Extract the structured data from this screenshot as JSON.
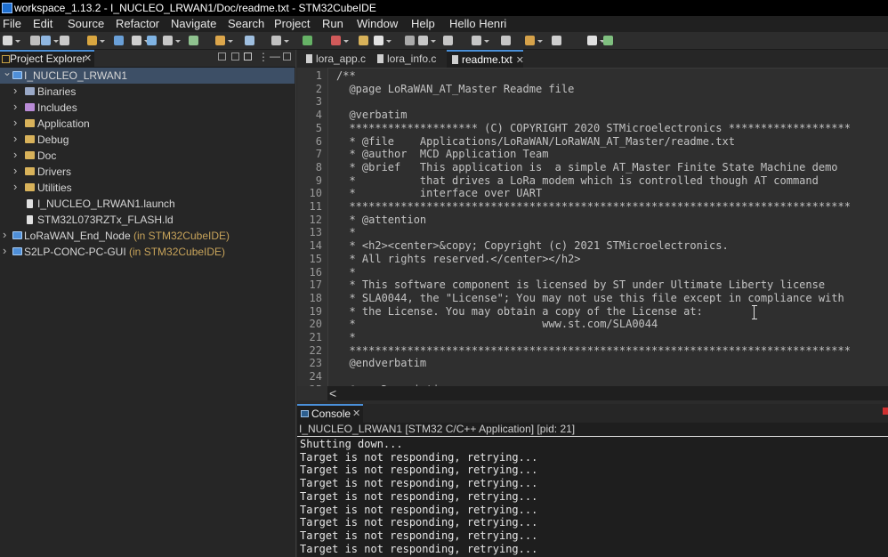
{
  "window": {
    "title": "workspace_1.13.2 - I_NUCLEO_LRWAN1/Doc/readme.txt - STM32CubeIDE"
  },
  "menu": [
    "File",
    "Edit",
    "Source",
    "Refactor",
    "Navigate",
    "Search",
    "Project",
    "Run",
    "Window",
    "Help",
    "Hello Henri"
  ],
  "project_explorer": {
    "tab_label": "Project Explorer",
    "close": "✕",
    "tree": [
      {
        "label": "I_NUCLEO_LRWAN1",
        "decoration": "",
        "icon": "project",
        "level": 0,
        "expanded": true,
        "selected": true
      },
      {
        "label": "Binaries",
        "decoration": "",
        "icon": "binaries",
        "level": 1,
        "expanded": false
      },
      {
        "label": "Includes",
        "decoration": "",
        "icon": "includes",
        "level": 1,
        "expanded": false
      },
      {
        "label": "Application",
        "decoration": "",
        "icon": "folder",
        "level": 1,
        "expanded": false
      },
      {
        "label": "Debug",
        "decoration": "",
        "icon": "folder",
        "level": 1,
        "expanded": false
      },
      {
        "label": "Doc",
        "decoration": "",
        "icon": "folder",
        "level": 1,
        "expanded": false
      },
      {
        "label": "Drivers",
        "decoration": "",
        "icon": "folder",
        "level": 1,
        "expanded": false
      },
      {
        "label": "Utilities",
        "decoration": "",
        "icon": "folder",
        "level": 1,
        "expanded": false
      },
      {
        "label": "I_NUCLEO_LRWAN1.launch",
        "decoration": "",
        "icon": "file",
        "level": 1,
        "leaf": true
      },
      {
        "label": "STM32L073RZTx_FLASH.ld",
        "decoration": "",
        "icon": "file",
        "level": 1,
        "leaf": true
      },
      {
        "label": "LoRaWAN_End_Node",
        "decoration": " (in STM32CubeIDE)",
        "icon": "project",
        "level": 0,
        "expanded": false
      },
      {
        "label": "S2LP-CONC-PC-GUI",
        "decoration": " (in STM32CubeIDE)",
        "icon": "project",
        "level": 0,
        "expanded": false
      }
    ]
  },
  "editor": {
    "tabs": [
      {
        "label": "lora_app.c",
        "active": false
      },
      {
        "label": "lora_info.c",
        "active": false
      },
      {
        "label": "readme.txt",
        "active": true
      }
    ],
    "lines": [
      "/**",
      "  @page LoRaWAN_AT_Master Readme file",
      "",
      "  @verbatim",
      "  ******************** (C) COPYRIGHT 2020 STMicroelectronics *******************",
      "  * @file    Applications/LoRaWAN/LoRaWAN_AT_Master/readme.txt",
      "  * @author  MCD Application Team",
      "  * @brief   This application is  a simple AT_Master Finite State Machine demo",
      "  *          that drives a LoRa modem which is controlled though AT command",
      "  *          interface over UART",
      "  ******************************************************************************",
      "  * @attention",
      "  *",
      "  * <h2><center>&copy; Copyright (c) 2021 STMicroelectronics.",
      "  * All rights reserved.</center></h2>",
      "  *",
      "  * This software component is licensed by ST under Ultimate Liberty license",
      "  * SLA0044, the \"License\"; You may not use this file except in compliance with",
      "  * the License. You may obtain a copy of the License at:",
      "  *                             www.st.com/SLA0044",
      "  *",
      "  ******************************************************************************",
      "  @endverbatim",
      "",
      "  @par Description"
    ],
    "scroll_left": "<"
  },
  "console": {
    "tab_label": "Console",
    "close": "✕",
    "status": "I_NUCLEO_LRWAN1 [STM32 C/C++ Application]  [pid: 21]",
    "output": [
      "Shutting down...",
      "Target is not responding, retrying...",
      "Target is not responding, retrying...",
      "Target is not responding, retrying...",
      "Target is not responding, retrying...",
      "Target is not responding, retrying...",
      "Target is not responding, retrying...",
      "Target is not responding, retrying...",
      "Target is not responding, retrying..."
    ]
  },
  "icons": {
    "app": "stm32cubeide-icon",
    "folder": "folder-icon",
    "file": "file-icon",
    "project": "project-icon",
    "binaries": "binaries-icon",
    "includes": "includes-icon",
    "console": "console-icon",
    "text_cursor": "text-cursor-icon"
  },
  "colors": {
    "accent": "#4a90d9",
    "tree_decoration": "#c7a35a",
    "folder": "#d8b25a",
    "editor_bg": "#2f2f2f",
    "console_bg": "#1e1e1e"
  }
}
